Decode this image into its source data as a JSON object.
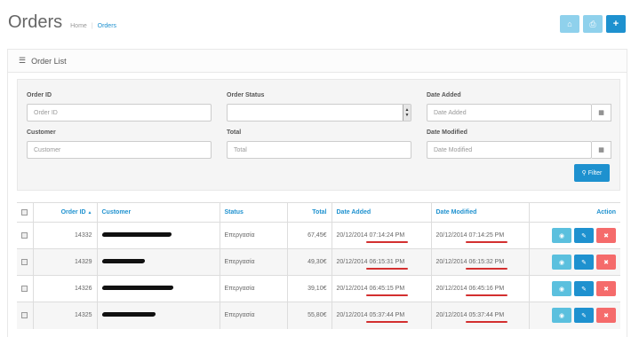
{
  "header": {
    "title": "Orders",
    "breadcrumb": [
      "Home",
      "Orders"
    ]
  },
  "header_buttons": [
    {
      "icon": "home-icon",
      "glyph": "⌂"
    },
    {
      "icon": "print-icon",
      "glyph": "⎙"
    },
    {
      "icon": "plus-icon",
      "glyph": "+"
    }
  ],
  "panel": {
    "title": "Order List",
    "icon": "list-icon"
  },
  "filter": {
    "order_id_label": "Order ID",
    "order_id_placeholder": "Order ID",
    "order_status_label": "Order Status",
    "order_status_value": "",
    "date_added_label": "Date Added",
    "date_added_placeholder": "Date Added",
    "customer_label": "Customer",
    "customer_placeholder": "Customer",
    "total_label": "Total",
    "total_placeholder": "Total",
    "date_modified_label": "Date Modified",
    "date_modified_placeholder": "Date Modified",
    "filter_button": "Filter"
  },
  "table": {
    "columns": [
      "Order ID",
      "Customer",
      "Status",
      "Total",
      "Date Added",
      "Date Modified",
      "Action"
    ],
    "sort_indicator": "▲",
    "rows": [
      {
        "order_id": "14332",
        "customer_redacted": true,
        "status": "Επεργασία",
        "total": "67,45€",
        "date_added": "20/12/2014 07:14:24 PM",
        "date_modified": "20/12/2014 07:14:25 PM"
      },
      {
        "order_id": "14329",
        "customer_redacted": true,
        "status": "Επεργασία",
        "total": "49,30€",
        "date_added": "20/12/2014 06:15:31 PM",
        "date_modified": "20/12/2014 06:15:32 PM"
      },
      {
        "order_id": "14326",
        "customer_redacted": true,
        "status": "Επεργασία",
        "total": "39,10€",
        "date_added": "20/12/2014 06:45:15 PM",
        "date_modified": "20/12/2014 06:45:16 PM"
      },
      {
        "order_id": "14325",
        "customer_redacted": true,
        "status": "Επεργασία",
        "total": "55,80€",
        "date_added": "20/12/2014 05:37:44 PM",
        "date_modified": "20/12/2014 05:37:44 PM"
      }
    ]
  },
  "colors": {
    "accent": "#1e91cf",
    "info": "#5bc0de",
    "danger": "#f56b6b",
    "annotation": "#d32f2f"
  }
}
